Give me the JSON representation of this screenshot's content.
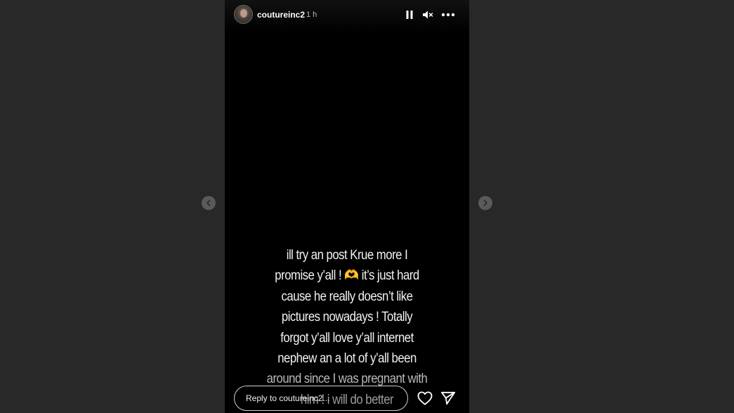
{
  "story": {
    "username": "coutureinc2",
    "time": "1 h",
    "caption_lines": [
      "ill try an post Krue more I",
      "promise y’all ! 🫶 it’s just hard",
      "cause he really doesn’t like",
      "pictures nowadays ! Totally",
      "forgot y’all love y’all internet",
      "nephew an a lot of y’all been",
      "around since I was pregnant with",
      "him ! i will do better"
    ]
  },
  "reply": {
    "placeholder": "Reply to coutureinc2..."
  },
  "icons": {
    "prev": "chevron-left-icon",
    "next": "chevron-right-icon",
    "pause": "pause-icon",
    "mute": "speaker-muted-icon",
    "more": "more-horizontal-icon",
    "like": "heart-icon",
    "share": "send-icon"
  },
  "colors": {
    "background": "#282828",
    "story_bg": "#000000",
    "text": "#f2f2f2"
  }
}
